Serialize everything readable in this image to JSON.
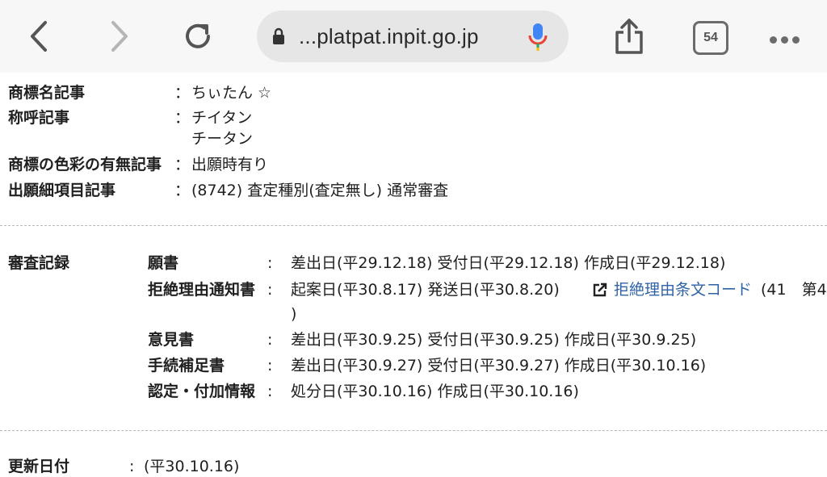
{
  "browser": {
    "url": "...platpat.inpit.go.jp",
    "tab_count": "54"
  },
  "trademark": {
    "name_label": "商標名記事",
    "name_value": "ちぃたん ☆",
    "pron_label": "称呼記事",
    "pron_values": [
      "チイタン",
      "チータン"
    ],
    "color_label": "商標の色彩の有無記事",
    "color_value": "出願時有り",
    "detail_label": "出願細項目記事",
    "detail_value": "(8742) 査定種別(査定無し) 通常審査",
    "colon": "："
  },
  "exam": {
    "section_label": "審査記録",
    "colon": ":",
    "rows": [
      {
        "label": "願書",
        "value": "差出日(平29.12.18) 受付日(平29.12.18) 作成日(平29.12.18)"
      },
      {
        "label": "拒絶理由通知書",
        "value": "起案日(平30.8.17) 発送日(平30.8.20)",
        "link": "拒絶理由条文コード",
        "link_tail": "(41　第4",
        "continuation": ")"
      },
      {
        "label": "意見書",
        "value": "差出日(平30.9.25) 受付日(平30.9.25) 作成日(平30.9.25)"
      },
      {
        "label": "手続補足書",
        "value": "差出日(平30.9.27) 受付日(平30.9.27) 作成日(平30.10.16)"
      },
      {
        "label": "認定・付加情報",
        "value": "処分日(平30.10.16) 作成日(平30.10.16)"
      }
    ]
  },
  "update": {
    "label": "更新日付",
    "colon": ":",
    "value": "(平30.10.16)"
  }
}
